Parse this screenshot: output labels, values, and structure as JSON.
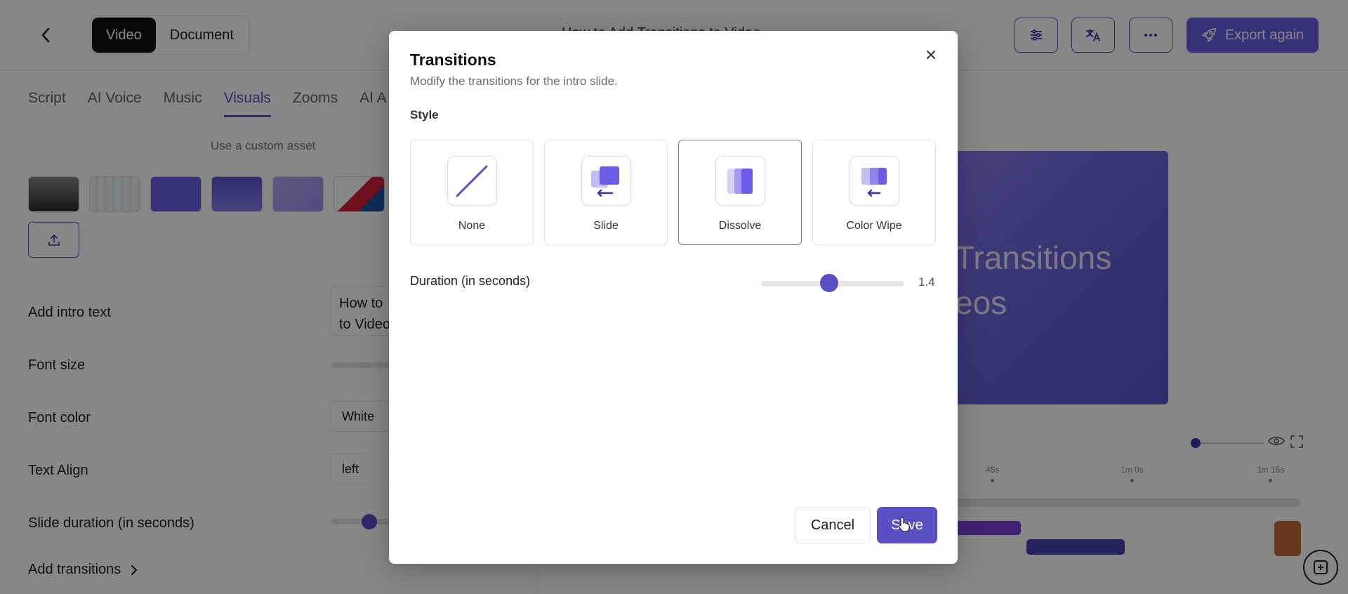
{
  "header": {
    "mode_tabs": [
      "Video",
      "Document"
    ],
    "title": "How to Add Transitions to Video",
    "export_label": "Export again",
    "icons": [
      "sliders-icon",
      "translate-icon",
      "more-icon",
      "rocket-icon"
    ]
  },
  "editor_tabs": [
    "Script",
    "AI Voice",
    "Music",
    "Visuals",
    "Zooms",
    "AI A"
  ],
  "visuals": {
    "custom_asset_label": "Use a custom asset",
    "intro_text_label": "Add intro text",
    "intro_text_value": "How to \nto Video",
    "font_size_label": "Font size",
    "font_color_label": "Font color",
    "font_color_value": "White",
    "text_align_label": "Text Align",
    "text_align_value": "left",
    "slide_duration_label": "Slide duration (in seconds)",
    "add_transitions_label": "Add transitions"
  },
  "preview": {
    "text_line1": "Transitions",
    "text_line2": "eos"
  },
  "timeline": {
    "ticks": [
      "45s",
      "1m 0s",
      "1m 15s"
    ]
  },
  "modal": {
    "title": "Transitions",
    "subtitle": "Modify the transitions for the intro slide.",
    "style_label": "Style",
    "options": [
      {
        "label": "None",
        "icon": "none-line-icon",
        "selected": false
      },
      {
        "label": "Slide",
        "icon": "slide-transition-icon",
        "selected": false
      },
      {
        "label": "Dissolve",
        "icon": "dissolve-transition-icon",
        "selected": true
      },
      {
        "label": "Color Wipe",
        "icon": "color-wipe-transition-icon",
        "selected": false
      }
    ],
    "duration_label": "Duration (in seconds)",
    "duration_value": "1.4",
    "cancel_label": "Cancel",
    "save_label": "Save"
  },
  "colors": {
    "accent": "#5b4fc4",
    "overlay": "rgba(0,0,0,0.47)"
  }
}
